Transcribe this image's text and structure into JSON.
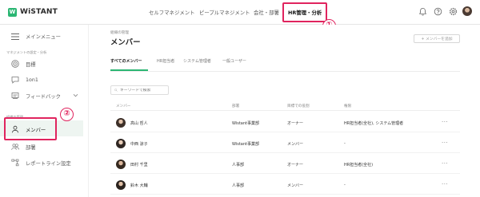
{
  "app": {
    "logo_mark": "W",
    "logo_text": "WiSTANT"
  },
  "topnav": {
    "items": [
      {
        "label": "セルフマネジメント"
      },
      {
        "label": "ピープルマネジメント"
      },
      {
        "label": "会社・部署"
      },
      {
        "label": "HR管理・分析"
      }
    ],
    "active_index": 3
  },
  "sidebar": {
    "menu_label": "メインメニュー",
    "section_self": "マネジメントの設定・分析",
    "items_self": [
      {
        "label": "目標",
        "icon": "target-icon"
      },
      {
        "label": "1on1",
        "icon": "chat-icon"
      },
      {
        "label": "フィードバック",
        "icon": "feedback-icon"
      }
    ],
    "section_org": "組織の管理",
    "items_org": [
      {
        "label": "メンバー",
        "icon": "person-icon"
      },
      {
        "label": "部署",
        "icon": "group-icon"
      },
      {
        "label": "レポートライン設定",
        "icon": "hierarchy-icon"
      }
    ]
  },
  "main": {
    "breadcrumb": "組織の管理",
    "title": "メンバー",
    "add_button": "+ メンバーを追加",
    "tabs": [
      {
        "label": "すべてのメンバー"
      },
      {
        "label": "HR担当者"
      },
      {
        "label": "システム管理者"
      },
      {
        "label": "一般ユーザー"
      }
    ],
    "search_placeholder": "キーワードで検索",
    "columns": [
      "メンバー",
      "部署",
      "目標での役割",
      "権限"
    ],
    "rows": [
      {
        "name": "高山 哲人",
        "dept": "Wistant事業部",
        "role": "オーナー",
        "perm": "HR担当者(全社), システム管理者",
        "more": "···"
      },
      {
        "name": "中西 涼子",
        "dept": "Wistant事業部",
        "role": "メンバー",
        "perm": "-",
        "more": "···"
      },
      {
        "name": "田村 千里",
        "dept": "人事部",
        "role": "オーナー",
        "perm": "HR担当者(全社)",
        "more": "···"
      },
      {
        "name": "鈴木 大輔",
        "dept": "人事部",
        "role": "メンバー",
        "perm": "-",
        "more": "···"
      }
    ]
  },
  "annotations": {
    "badge_1": "①",
    "badge_2": "②"
  },
  "colors": {
    "accent": "#2bb673",
    "annotation": "#e0245e"
  }
}
